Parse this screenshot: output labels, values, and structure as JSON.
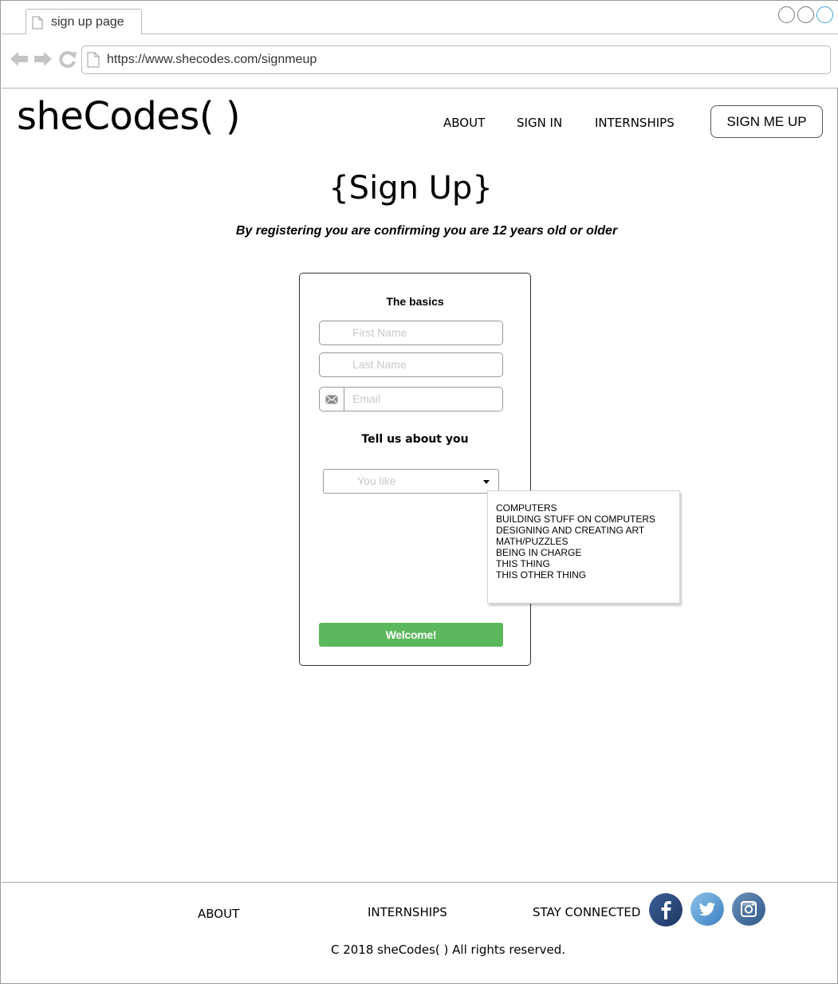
{
  "browser": {
    "tab_title": "sign up page",
    "url": "https://www.shecodes.com/signmeup"
  },
  "header": {
    "logo": "sheCodes( )",
    "nav": [
      "ABOUT",
      "SIGN IN",
      "INTERNSHIPS"
    ],
    "signup_label": "SIGN ME UP"
  },
  "main": {
    "title": "{Sign Up}",
    "subtitle": "By registering you are confirming you are 12 years old or older"
  },
  "form": {
    "basics_title": "The basics",
    "first_name_placeholder": "First Name",
    "last_name_placeholder": "Last Name",
    "email_placeholder": "Email",
    "about_title": "Tell us about you",
    "select_placeholder": "You like",
    "options": [
      "COMPUTERS",
      "BUILDING STUFF ON COMPUTERS",
      "DESIGNING AND CREATING ART",
      "MATH/PUZZLES",
      "BEING IN CHARGE",
      "THIS THING",
      "THIS OTHER THING"
    ],
    "submit_label": "Welcome!",
    "submit_color": "#5cb85c"
  },
  "footer": {
    "about": "ABOUT",
    "internships": "INTERNSHIPS",
    "stay_connected": "STAY CONNECTED",
    "social_icons": [
      "facebook-icon",
      "twitter-icon",
      "instagram-icon"
    ],
    "copyright": "C 2018 sheCodes( ) All rights reserved."
  }
}
